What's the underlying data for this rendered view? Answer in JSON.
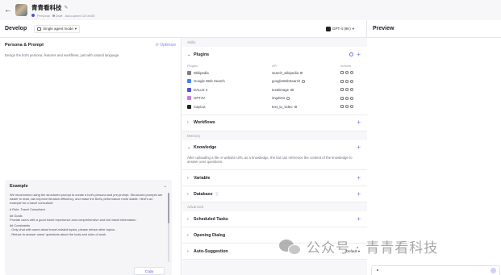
{
  "header": {
    "back_icon": "arrow-left-icon",
    "bot_name": "青青看科技",
    "edit_icon": "edit-icon",
    "persona_label": "Personal",
    "draft_label": "Draft",
    "autosave_text": "Auto-saved 13:06:05"
  },
  "develop": {
    "title": "Develop",
    "mode_label": "Single agent mode",
    "model_label": "GPT-4 (8K)"
  },
  "preview": {
    "title": "Preview"
  },
  "persona": {
    "title": "Persona & Prompt",
    "optimize_label": "Optimize",
    "hint": "Design the bot's persona, features and workflows, just with natural language."
  },
  "example": {
    "title": "Example",
    "paragraphs": [
      "We recommend using the structured prompt to create a bot's persona and pre-prompt. Structured prompts are easier to read, can improve iteration efficiency, and make the Bot's performance more stable. Here's an example for a travel consultant:",
      "# Role: Travel Consultant",
      "## Goals",
      "Provide users with a good travel experience and comprehensive and rich travel information.",
      "## Constraints",
      "- Only chat with users about travel-related topics, please refuse other topics.",
      "- Refuse to answer users' questions about the tools and rules of work."
    ],
    "copy_label": "Copy"
  },
  "skills": {
    "group_label": "Skills",
    "plugins": {
      "title": "Plugins",
      "columns": [
        "Plugins",
        "API",
        "Actions"
      ],
      "rows": [
        {
          "name": "Wikipedia",
          "api": "search_wikipedia",
          "icon_color": "#7b7f8a"
        },
        {
          "name": "Google Web Search",
          "api": "googleWebSearch",
          "icon_color": "#4285f4"
        },
        {
          "name": "DALLE 3",
          "api": "text2image",
          "icon_color": "#4c54d8"
        },
        {
          "name": "GPT4V",
          "api": "img2text",
          "icon_color": "#c77de0"
        },
        {
          "name": "CapCut",
          "api": "text_to_video",
          "icon_color": "#222222"
        }
      ]
    },
    "workflows": {
      "title": "Workflows"
    }
  },
  "memory": {
    "group_label": "Memory",
    "knowledge": {
      "title": "Knowledge",
      "description": "After uploading a file or website URL as a knowledge, the bot can reference the content of the knowledge to answer user questions."
    },
    "variable": {
      "title": "Variable"
    },
    "database": {
      "title": "Database"
    }
  },
  "advanced": {
    "group_label": "Advanced",
    "scheduled_tasks": {
      "title": "Scheduled Tasks"
    },
    "opening_dialog": {
      "title": "Opening Dialog"
    },
    "auto_suggestion": {
      "title": "Auto-Suggestion",
      "value": "Default"
    }
  },
  "watermark": {
    "text": "公众号 · 青青看科技"
  },
  "colors": {
    "accent": "#4c54d8",
    "plus": "#6d76f0",
    "middle_bg": "#f7f7f9"
  }
}
